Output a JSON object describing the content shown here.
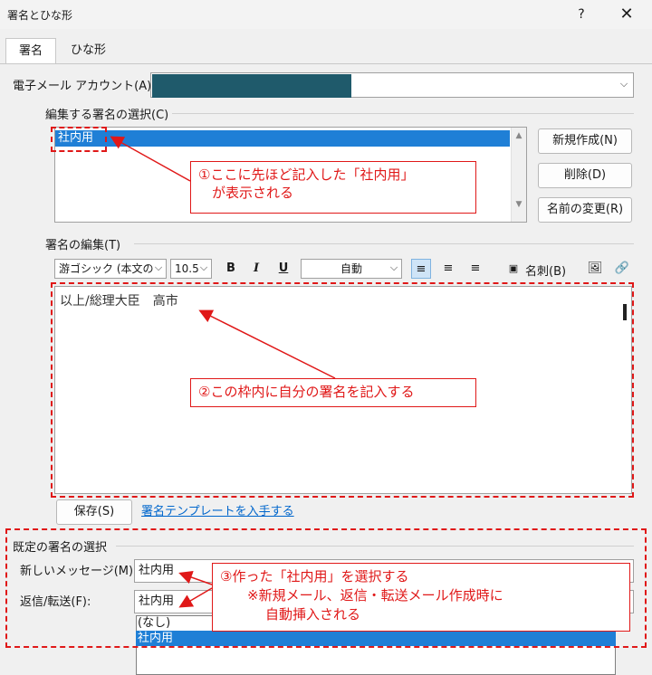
{
  "window": {
    "title": "署名とひな形",
    "help_label": "?",
    "close_label": "✕"
  },
  "tabs": [
    {
      "label": "署名"
    },
    {
      "label": "ひな形"
    }
  ],
  "account": {
    "label": "電子メール アカウント(A):",
    "value": ""
  },
  "select_signature": {
    "group_label": "編集する署名の選択(C)",
    "items": [
      "社内用"
    ],
    "buttons": {
      "new": "新規作成(N)",
      "delete": "削除(D)",
      "rename": "名前の変更(R)"
    }
  },
  "edit_signature": {
    "group_label": "署名の編集(T)",
    "font_name": "游ゴシック (本文の",
    "font_size": "10.5",
    "bold": "B",
    "italic": "I",
    "underline": "U",
    "color": "自動",
    "business_card": "名刺(B)",
    "body": "以上/総理大臣　高市",
    "save": "保存(S)",
    "template_link": "署名テンプレートを入手する"
  },
  "default_signature": {
    "group_label": "既定の署名の選択",
    "new_message_label": "新しいメッセージ(M):",
    "new_message_value": "社内用",
    "reply_label": "返信/転送(F):",
    "reply_value": "社内用",
    "dropdown_options": [
      "(なし)",
      "社内用"
    ]
  },
  "callouts": {
    "c1_line1": "①ここに先ほど記入した「社内用」",
    "c1_line2": "　が表示される",
    "c2": "②この枠内に自分の署名を記入する",
    "c3_line1": "③作った「社内用」を選択する",
    "c3_line2": "※新規メール、返信・転送メール作成時に",
    "c3_line3": "自動挿入される"
  },
  "colors": {
    "selection": "#1f7fd6",
    "annotation": "#e01818",
    "account_redact": "#1f5a6b"
  }
}
